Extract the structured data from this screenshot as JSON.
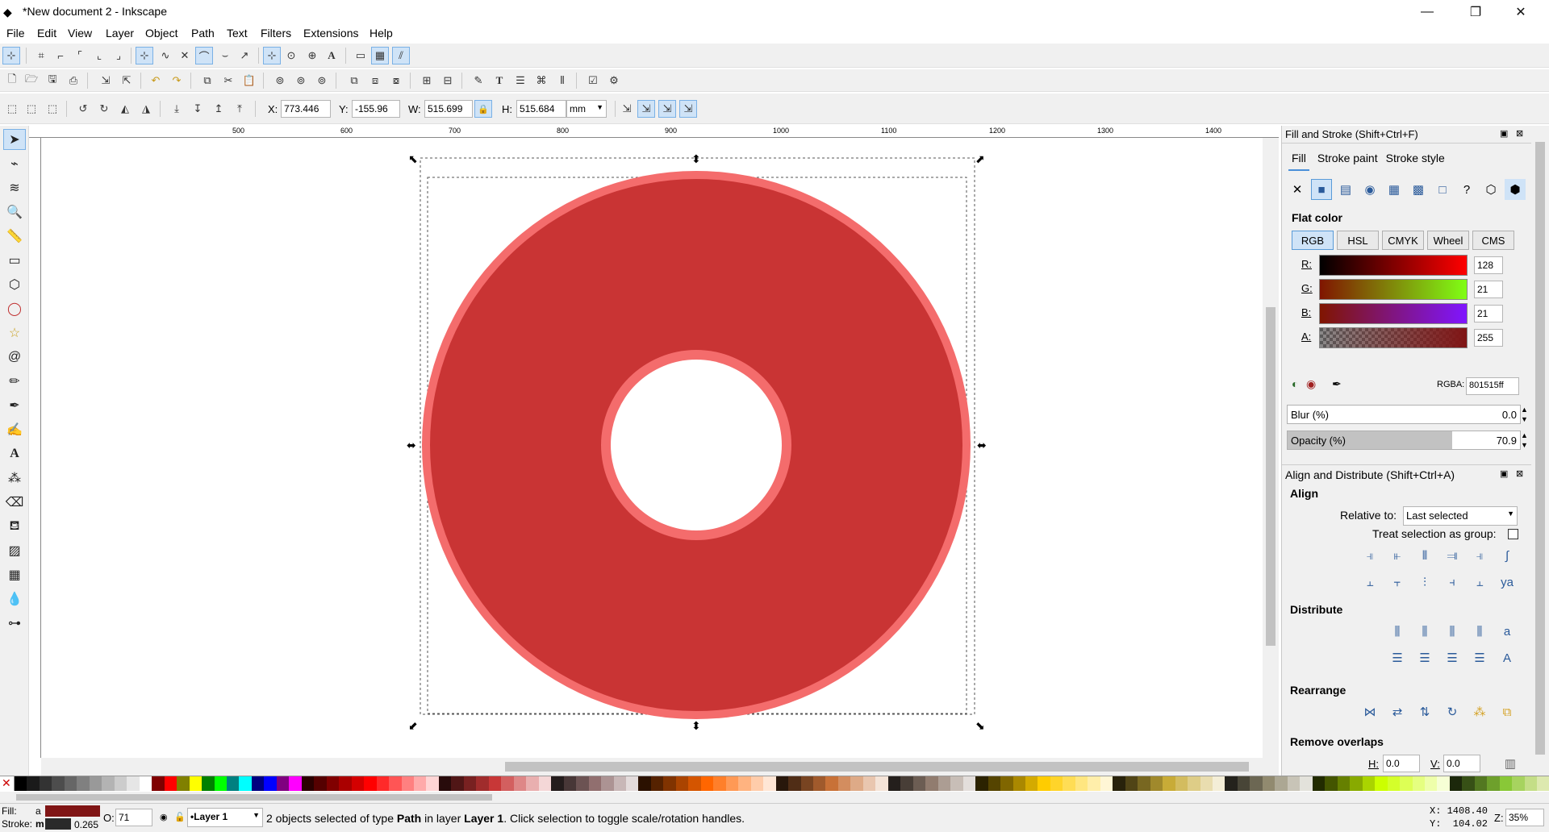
{
  "window": {
    "title": "*New document 2 - Inkscape",
    "min": "—",
    "max": "❐",
    "close": "✕"
  },
  "menu": [
    "File",
    "Edit",
    "View",
    "Layer",
    "Object",
    "Path",
    "Text",
    "Filters",
    "Extensions",
    "Help"
  ],
  "selector_toolbar": {
    "x_label": "X:",
    "x_value": "773.446",
    "y_label": "Y:",
    "y_value": "-155.96",
    "w_label": "W:",
    "w_value": "515.699",
    "h_label": "H:",
    "h_value": "515.684",
    "unit": "mm"
  },
  "ruler": {
    "labels": [
      "500",
      "600",
      "700",
      "800",
      "900",
      "1000",
      "1100",
      "1200",
      "1300",
      "1400"
    ]
  },
  "fill_stroke": {
    "title": "Fill and Stroke (Shift+Ctrl+F)",
    "tabs": [
      "Fill",
      "Stroke paint",
      "Stroke style"
    ],
    "flat_color": "Flat color",
    "modes": [
      "RGB",
      "HSL",
      "CMYK",
      "Wheel",
      "CMS"
    ],
    "r_label": "R:",
    "r_value": "128",
    "g_label": "G:",
    "g_value": "21",
    "b_label": "B:",
    "b_value": "21",
    "a_label": "A:",
    "a_value": "255",
    "rgba_label": "RGBA:",
    "rgba_value": "801515ff",
    "blur_label": "Blur (%)",
    "blur_value": "0.0",
    "opacity_label": "Opacity (%)",
    "opacity_value": "70.9",
    "opacity_fraction": 0.709
  },
  "align": {
    "title": "Align and Distribute (Shift+Ctrl+A)",
    "align_heading": "Align",
    "relative_label": "Relative to:",
    "relative_value": "Last selected",
    "treat_group_label": "Treat selection as group:",
    "distribute_heading": "Distribute",
    "rearrange_heading": "Rearrange",
    "remove_overlaps_heading": "Remove overlaps",
    "h_label": "H:",
    "h_value": "0.0",
    "v_label": "V:",
    "v_value": "0.0"
  },
  "status": {
    "fill_label": "Fill:",
    "fill_a": "a",
    "stroke_label": "Stroke:",
    "stroke_m": "m",
    "stroke_width": "0.265",
    "o_label": "O:",
    "o_value": "71",
    "layer": "•Layer 1",
    "message_pre": "2 objects selected of type ",
    "message_type": "Path",
    "message_mid": " in layer ",
    "message_layer": "Layer 1",
    "message_post": ". Click selection to toggle scale/rotation handles.",
    "x_coord": "X: 1408.40",
    "y_coord": "Y:  104.02",
    "z_label": "Z:",
    "zoom": "35%"
  },
  "colors": {
    "fill": "#801515",
    "ring_outer": "#f46c6c",
    "ring_inner": "#c93434",
    "accent": "#cfe3f7"
  },
  "palette": [
    "#000000",
    "#1a1a1a",
    "#333333",
    "#4d4d4d",
    "#666666",
    "#808080",
    "#999999",
    "#b3b3b3",
    "#cccccc",
    "#e6e6e6",
    "#ffffff",
    "#800000",
    "#ff0000",
    "#808000",
    "#ffff00",
    "#008000",
    "#00ff00",
    "#008080",
    "#00ffff",
    "#000080",
    "#0000ff",
    "#800080",
    "#ff00ff",
    "#2b0000",
    "#550000",
    "#800000",
    "#aa0000",
    "#d40000",
    "#ff0000",
    "#ff2a2a",
    "#ff5555",
    "#ff8080",
    "#ffaaaa",
    "#ffd5d5",
    "#280b0b",
    "#501616",
    "#782121",
    "#a02c2c",
    "#c83737",
    "#d35f5f",
    "#de8787",
    "#e9afaf",
    "#f4d7d7",
    "#241c1c",
    "#483737",
    "#6c5353",
    "#916f6f",
    "#ac9393",
    "#c8b7b7",
    "#e3dbdb",
    "#2b1100",
    "#552200",
    "#803300",
    "#aa4400",
    "#d45500",
    "#ff6600",
    "#ff7f2a",
    "#ff9955",
    "#ffb380",
    "#ffccaa",
    "#ffe6d5",
    "#28170b",
    "#502d16",
    "#784421",
    "#a05a2c",
    "#c87137",
    "#d38d5f",
    "#deaa87",
    "#e9c6af",
    "#f4e3d7",
    "#241f1c",
    "#483e37",
    "#6c5d53",
    "#917c6f",
    "#ac9d93",
    "#c8beb7",
    "#e3dedb",
    "#2b2200",
    "#554400",
    "#806600",
    "#aa8800",
    "#d4aa00",
    "#ffcc00",
    "#ffd42a",
    "#ffdd55",
    "#ffe680",
    "#ffeeaa",
    "#fff6d5",
    "#28220b",
    "#504416",
    "#786721",
    "#a0892c",
    "#c8ab37",
    "#d3bc5f",
    "#decd87",
    "#e9ddaf",
    "#f4eed7",
    "#24221c",
    "#484537",
    "#6c6753",
    "#918a6f",
    "#aca793",
    "#c8c4b7",
    "#e3e2db",
    "#222b00",
    "#445500",
    "#668000",
    "#88aa00",
    "#aad400",
    "#ccff00",
    "#d4ff2a",
    "#ddff55",
    "#e5ff80",
    "#eeffaa",
    "#f6ffd5",
    "#1c280b",
    "#375016",
    "#537821",
    "#6ea02c",
    "#89c837",
    "#a7d35f",
    "#c4de87",
    "#dde9af"
  ]
}
